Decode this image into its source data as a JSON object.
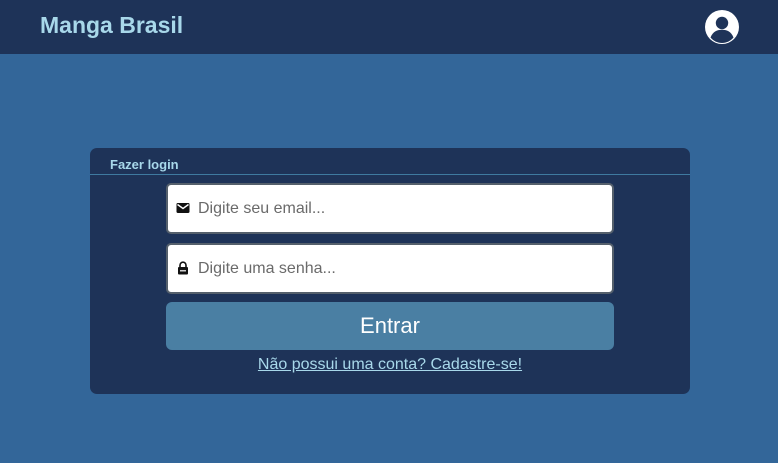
{
  "header": {
    "brand": "Manga Brasil",
    "user_icon": "user-circle-icon"
  },
  "login": {
    "title": "Fazer login",
    "email": {
      "icon": "envelope-icon",
      "placeholder": "Digite seu email...",
      "value": ""
    },
    "password": {
      "icon": "lock-icon",
      "placeholder": "Digite uma senha...",
      "value": ""
    },
    "submit_label": "Entrar",
    "signup_link": "Não possui uma conta? Cadastre-se!"
  },
  "colors": {
    "background": "#336699",
    "panel": "#1e3358",
    "accent_text": "#a8d8ea",
    "button": "#4a7fa3"
  }
}
